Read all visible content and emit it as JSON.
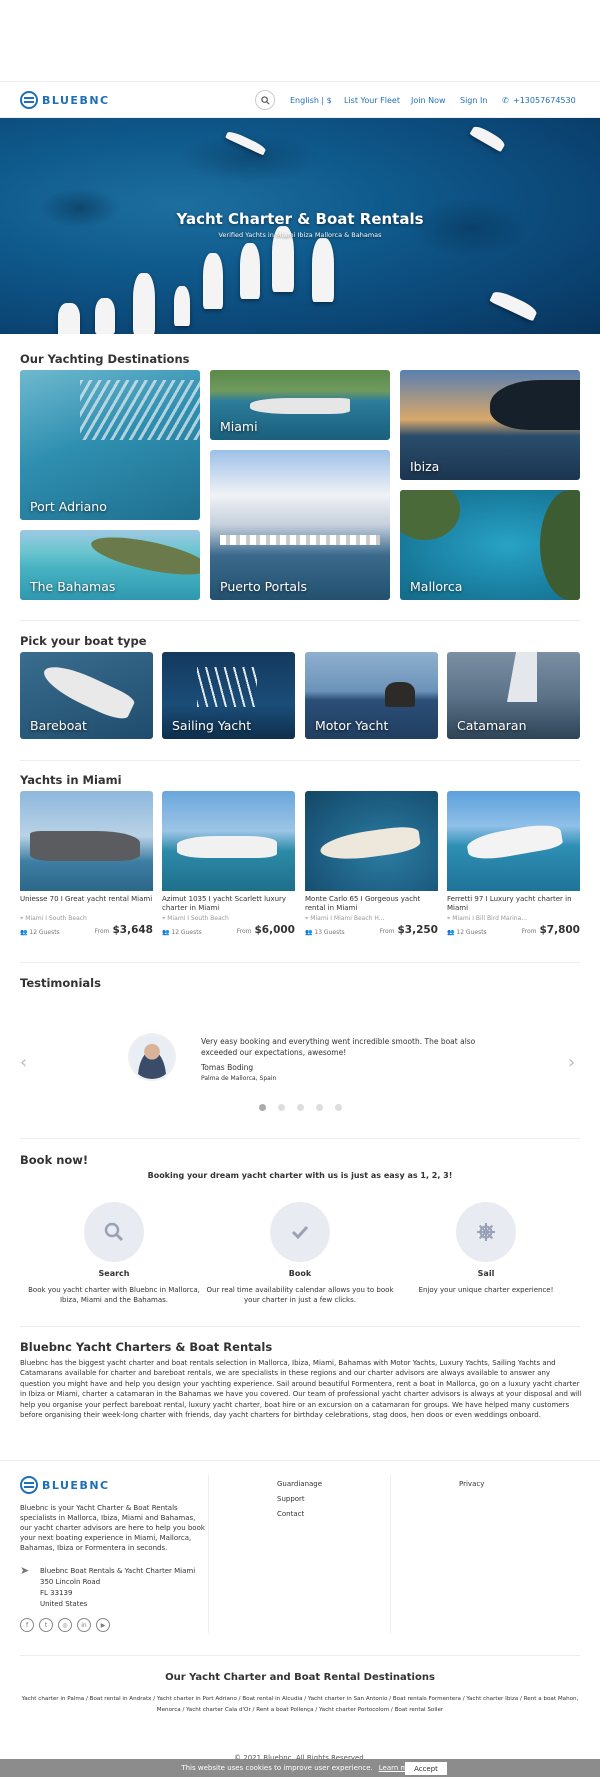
{
  "header": {
    "logo_text": "BLUEBNC",
    "nav": [
      "English | $",
      "List Your Fleet",
      "Join Now",
      "Sign In",
      "+13057674530"
    ]
  },
  "hero": {
    "title": "Yacht Charter & Boat Rentals",
    "subtitle": "Verified Yachts in Miami Ibiza Mallorca & Bahamas"
  },
  "destinations": {
    "title": "Our Yachting Destinations",
    "items": [
      "Port Adriano",
      "Miami",
      "Ibiza",
      "The Bahamas",
      "Puerto Portals",
      "Mallorca"
    ]
  },
  "boat_types": {
    "title": "Pick your boat type",
    "items": [
      "Bareboat",
      "Sailing Yacht",
      "Motor Yacht",
      "Catamaran"
    ]
  },
  "yachts": {
    "title": "Yachts in Miami",
    "from_label": "From",
    "items": [
      {
        "name": "Uniesse 70 I Great yacht rental Miami",
        "location": "Miami I South Beach",
        "guests": "12 Guests",
        "price": "$3,648"
      },
      {
        "name": "Azimut 1035 I yacht Scarlett luxury charter in Miami",
        "location": "Miami I South Beach",
        "guests": "12 Guests",
        "price": "$6,000"
      },
      {
        "name": "Monte Carlo 65 I Gorgeous yacht rental in Miami",
        "location": "Miami I Miami Beach H...",
        "guests": "13 Guests",
        "price": "$3,250"
      },
      {
        "name": "Ferretti 97 I Luxury yacht charter in Miami",
        "location": "Miami I Bill Bird Marina...",
        "guests": "12 Guests",
        "price": "$7,800"
      }
    ]
  },
  "testimonials": {
    "title": "Testimonials",
    "quote": "Very easy booking and everything went incredible smooth. The boat also exceeded our expectations, awesome!",
    "author": "Tomas Boding",
    "location": "Palma de Mallorca, Spain",
    "prev_icon": "chevron-left-icon",
    "next_icon": "chevron-right-icon"
  },
  "book_now": {
    "title": "Book now!",
    "subtitle": "Booking your dream yacht charter with us is just as easy as 1, 2, 3!",
    "steps": [
      {
        "icon": "search-icon",
        "title": "Search",
        "desc": "Book you yacht charter with Bluebnc in Mallorca, Ibiza, Miami and the Bahamas."
      },
      {
        "icon": "check-icon",
        "title": "Book",
        "desc": "Our real time availability calendar allows you to book your charter in just a few clicks."
      },
      {
        "icon": "helm-icon",
        "title": "Sail",
        "desc": "Enjoy your unique charter experience!"
      }
    ]
  },
  "about": {
    "title": "Bluebnc Yacht Charters & Boat Rentals",
    "text": "Bluebnc has the biggest yacht charter and boat rentals selection in Mallorca, Ibiza, Miami, Bahamas with Motor Yachts, Luxury Yachts, Sailing Yachts and Catamarans available for charter and bareboat rentals, we are specialists in these regions and our charter advisors are always available to answer any question you might have and help you design your yachting experience. Sail around beautiful Formentera, rent a boat in Mallorca, go on a luxury yacht charter in Ibiza or Miami, charter a catamaran in the Bahamas we have you covered. Our team of professional yacht charter advisors is always at your disposal and will help you organise your perfect bareboat rental, luxury yacht charter, boat hire or an excursion on a catamaran for groups. We have helped many customers before organising their week-long charter with friends, day yacht charters for birthday celebrations, stag doos, hen doos or even weddings onboard."
  },
  "footer": {
    "logo_text": "BLUEBNC",
    "description": "Bluebnc is your Yacht Charter & Boat Rentals specialists in Mallorca, Ibiza, Miami and Bahamas, our yacht charter advisors are here to help you book your next boating experience in Miami, Mallorca, Bahamas, Ibiza or Formentera in seconds.",
    "address_name": "Bluebnc Boat Rentals & Yacht Charter Miami",
    "address_street": "350 Lincoln Road",
    "address_zip": "FL 33139",
    "address_country": "United States",
    "social": [
      "f",
      "t",
      "ig",
      "in",
      "yt"
    ],
    "links_col1": [
      "Guardianage",
      "Support",
      "Contact"
    ],
    "links_col2": [
      "Privacy"
    ],
    "destinations_title": "Our Yacht Charter and Boat Rental Destinations",
    "destination_links": "Yacht charter in Palma  /  Boat rental in Andratx  /  Yacht charter in Port Adriano  /  Boat rental in Alcudia  /  Yacht charter in San Antonio  /  Boat rentals Formentera  /  Yacht charter Ibiza  /  Rent a boat Mahon, Menorca  /  Yacht charter Cala d'Or  /  Rent a boat Pollença  /  Yacht charter Portocolom  /  Boat rental Soller",
    "copyright": "© 2021 Bluebnc. All Rights Reserved."
  },
  "cookie": {
    "message": "This website uses cookies to improve user experience.",
    "learn_more": "Learn more",
    "accept": "Accept"
  }
}
